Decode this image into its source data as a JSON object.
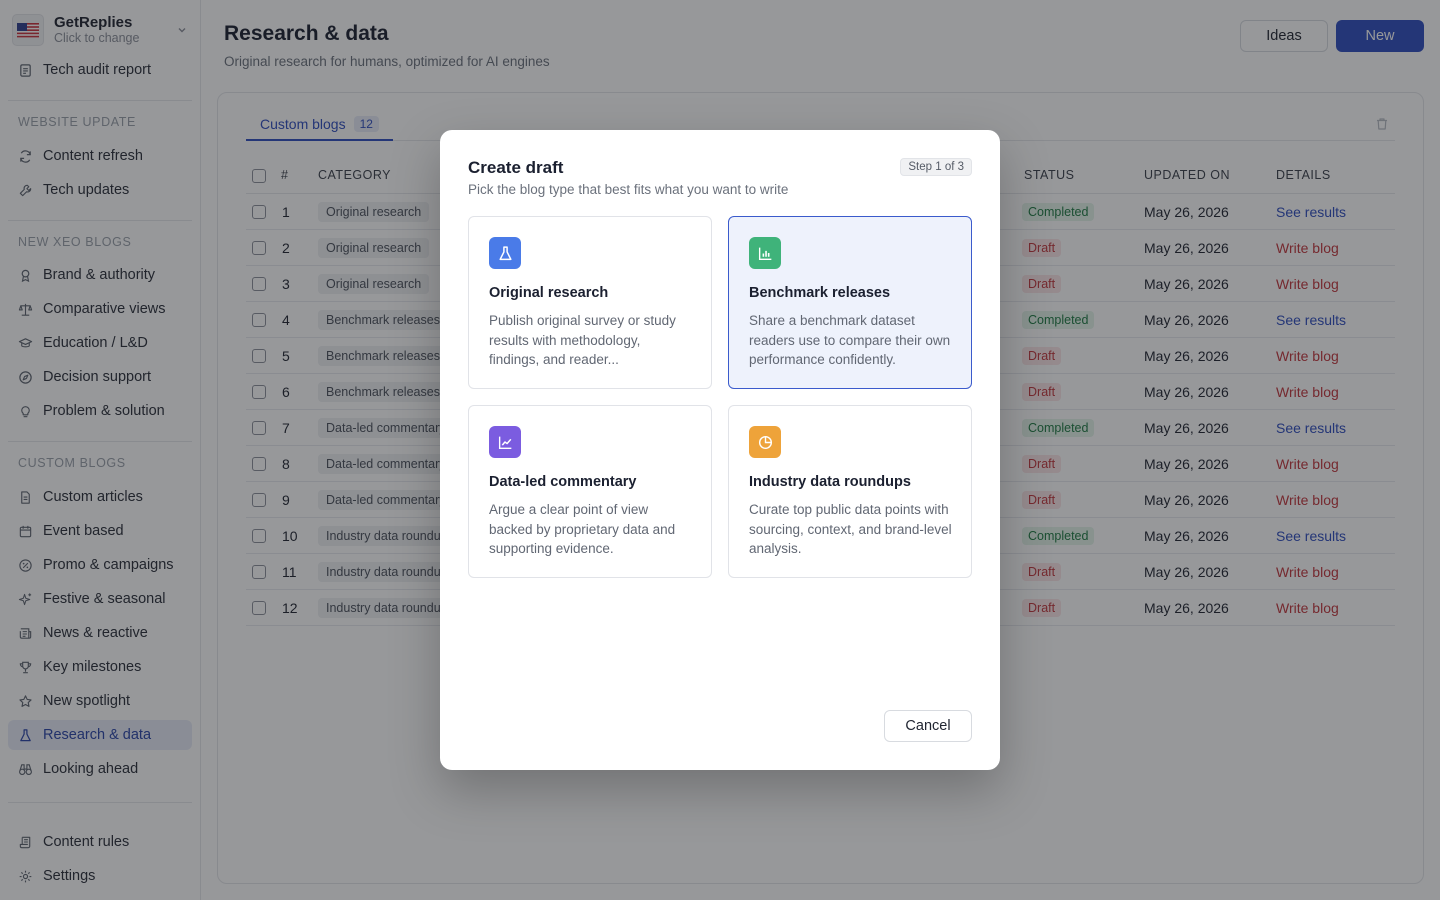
{
  "org": {
    "name": "GetReplies",
    "subtitle": "Click to change",
    "flag": "us-flag-icon"
  },
  "sidebar": {
    "top_item": {
      "label": "Tech audit report",
      "icon": "report-icon"
    },
    "sections": [
      {
        "title": "WEBSITE UPDATE",
        "items": [
          {
            "label": "Content refresh",
            "icon": "refresh-icon"
          },
          {
            "label": "Tech updates",
            "icon": "wrench-icon"
          }
        ]
      },
      {
        "title": "NEW XEO BLOGS",
        "items": [
          {
            "label": "Brand & authority",
            "icon": "award-icon"
          },
          {
            "label": "Comparative views",
            "icon": "scale-icon"
          },
          {
            "label": "Education / L&D",
            "icon": "graduation-cap-icon"
          },
          {
            "label": "Decision support",
            "icon": "compass-icon"
          },
          {
            "label": "Problem & solution",
            "icon": "lightbulb-icon"
          }
        ]
      },
      {
        "title": "CUSTOM BLOGS",
        "items": [
          {
            "label": "Custom articles",
            "icon": "file-text-icon"
          },
          {
            "label": "Event based",
            "icon": "calendar-icon"
          },
          {
            "label": "Promo & campaigns",
            "icon": "percent-badge-icon"
          },
          {
            "label": "Festive & seasonal",
            "icon": "sparkles-icon"
          },
          {
            "label": "News & reactive",
            "icon": "newspaper-icon"
          },
          {
            "label": "Key milestones",
            "icon": "trophy-icon"
          },
          {
            "label": "New spotlight",
            "icon": "star-icon"
          },
          {
            "label": "Research & data",
            "icon": "flask-icon",
            "active": true
          },
          {
            "label": "Looking ahead",
            "icon": "binoculars-icon"
          }
        ]
      }
    ],
    "bottom_items": [
      {
        "label": "Content rules",
        "icon": "scroll-icon"
      },
      {
        "label": "Settings",
        "icon": "gear-icon"
      }
    ]
  },
  "header": {
    "title": "Research & data",
    "subtitle": "Original research for humans, optimized for AI engines",
    "ideas_label": "Ideas",
    "new_label": "New"
  },
  "tabs": [
    {
      "label": "Custom blogs",
      "count": "12"
    }
  ],
  "table": {
    "columns": {
      "num": "#",
      "category": "CATEGORY",
      "status": "STATUS",
      "updated": "UPDATED ON",
      "details": "DETAILS"
    },
    "rows": [
      {
        "num": "1",
        "category": "Original research",
        "status": "Completed",
        "date": "May 26, 2026",
        "action": "See results"
      },
      {
        "num": "2",
        "category": "Original research",
        "status": "Draft",
        "date": "May 26, 2026",
        "action": "Write blog"
      },
      {
        "num": "3",
        "category": "Original research",
        "status": "Draft",
        "date": "May 26, 2026",
        "action": "Write blog"
      },
      {
        "num": "4",
        "category": "Benchmark releases",
        "status": "Completed",
        "date": "May 26, 2026",
        "action": "See results"
      },
      {
        "num": "5",
        "category": "Benchmark releases",
        "status": "Draft",
        "date": "May 26, 2026",
        "action": "Write blog"
      },
      {
        "num": "6",
        "category": "Benchmark releases",
        "status": "Draft",
        "date": "May 26, 2026",
        "action": "Write blog"
      },
      {
        "num": "7",
        "category": "Data-led commentary",
        "status": "Completed",
        "date": "May 26, 2026",
        "action": "See results"
      },
      {
        "num": "8",
        "category": "Data-led commentary",
        "status": "Draft",
        "date": "May 26, 2026",
        "action": "Write blog"
      },
      {
        "num": "9",
        "category": "Data-led commentary",
        "status": "Draft",
        "date": "May 26, 2026",
        "action": "Write blog"
      },
      {
        "num": "10",
        "category": "Industry data roundups",
        "status": "Completed",
        "date": "May 26, 2026",
        "action": "See results"
      },
      {
        "num": "11",
        "category": "Industry data roundups",
        "status": "Draft",
        "date": "May 26, 2026",
        "action": "Write blog"
      },
      {
        "num": "12",
        "category": "Industry data roundups",
        "status": "Draft",
        "date": "May 26, 2026",
        "action": "Write blog"
      }
    ]
  },
  "modal": {
    "title": "Create draft",
    "subtitle": "Pick the blog type that best fits what you want to write",
    "step": "Step 1 of 3",
    "options": [
      {
        "title": "Original research",
        "description": "Publish original survey or study results with methodology, findings, and reader...",
        "icon": "flask-icon",
        "color": "#4a7be8",
        "selected": false
      },
      {
        "title": "Benchmark releases",
        "description": "Share a benchmark dataset readers use to compare their own performance confidently.",
        "icon": "bar-chart-icon",
        "color": "#3fb37a",
        "selected": true
      },
      {
        "title": "Data-led commentary",
        "description": "Argue a clear point of view backed by proprietary data and supporting evidence.",
        "icon": "line-chart-icon",
        "color": "#7b5ce0",
        "selected": false
      },
      {
        "title": "Industry data roundups",
        "description": "Curate top public data points with sourcing, context, and brand-level analysis.",
        "icon": "pie-chart-icon",
        "color": "#eea33a",
        "selected": false
      }
    ],
    "cancel_label": "Cancel"
  }
}
